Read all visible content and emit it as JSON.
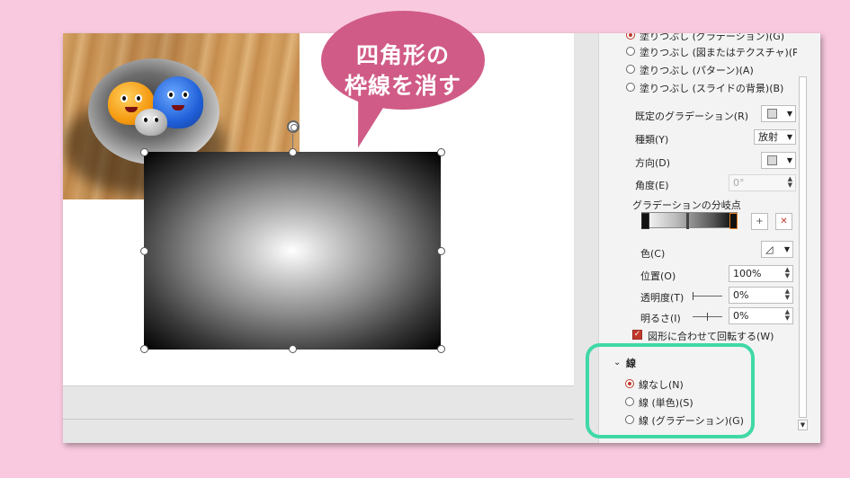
{
  "callout": {
    "line1": "四角形の",
    "line2": "枠線を消す"
  },
  "fill_options": [
    {
      "label": "塗りつぶし (グラデーション)(G)",
      "selected": true
    },
    {
      "label": "塗りつぶし (図またはテクスチャ)(P)",
      "selected": false
    },
    {
      "label": "塗りつぶし (パターン)(A)",
      "selected": false
    },
    {
      "label": "塗りつぶし (スライドの背景)(B)",
      "selected": false
    }
  ],
  "gradient": {
    "preset_label": "既定のグラデーション(R)",
    "type_label": "種類(Y)",
    "type_value": "放射",
    "direction_label": "方向(D)",
    "angle_label": "角度(E)",
    "angle_value": "0°",
    "stops_label": "グラデーションの分岐点",
    "color_label": "色(C)",
    "position_label": "位置(O)",
    "position_value": "100%",
    "transparency_label": "透明度(T)",
    "transparency_value": "0%",
    "brightness_label": "明るさ(I)",
    "brightness_value": "0%",
    "rotate_label": "図形に合わせて回転する(W)",
    "rotate_checked": true
  },
  "line_section": {
    "title": "線",
    "options": [
      {
        "label": "線なし(N)",
        "selected": true
      },
      {
        "label": "線 (単色)(S)",
        "selected": false
      },
      {
        "label": "線 (グラデーション)(G)",
        "selected": false
      }
    ]
  },
  "colors": {
    "background": "#f9c9df",
    "callout": "#d05b86",
    "highlight": "#3fd8a7",
    "accent": "#c0392b"
  }
}
